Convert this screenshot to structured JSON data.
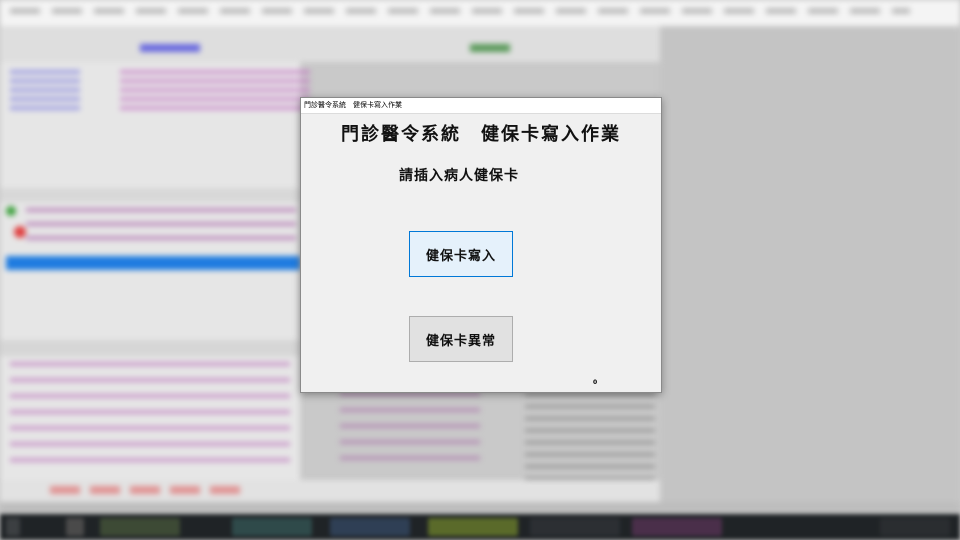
{
  "dialog": {
    "title": "門診醫令系統　健保卡寫入作業",
    "heading": "門診醫令系統　健保卡寫入作業",
    "prompt": "請插入病人健保卡",
    "write_button": "健保卡寫入",
    "error_button": "健保卡異常",
    "counter": "0"
  },
  "colors": {
    "dialog_bg": "#f0f0f0",
    "primary_button_bg": "#e5f1fb",
    "primary_button_border": "#0078d7",
    "secondary_button_bg": "#e1e1e1",
    "background_app": "#c9c9c9",
    "taskbar": "#1f2326"
  }
}
